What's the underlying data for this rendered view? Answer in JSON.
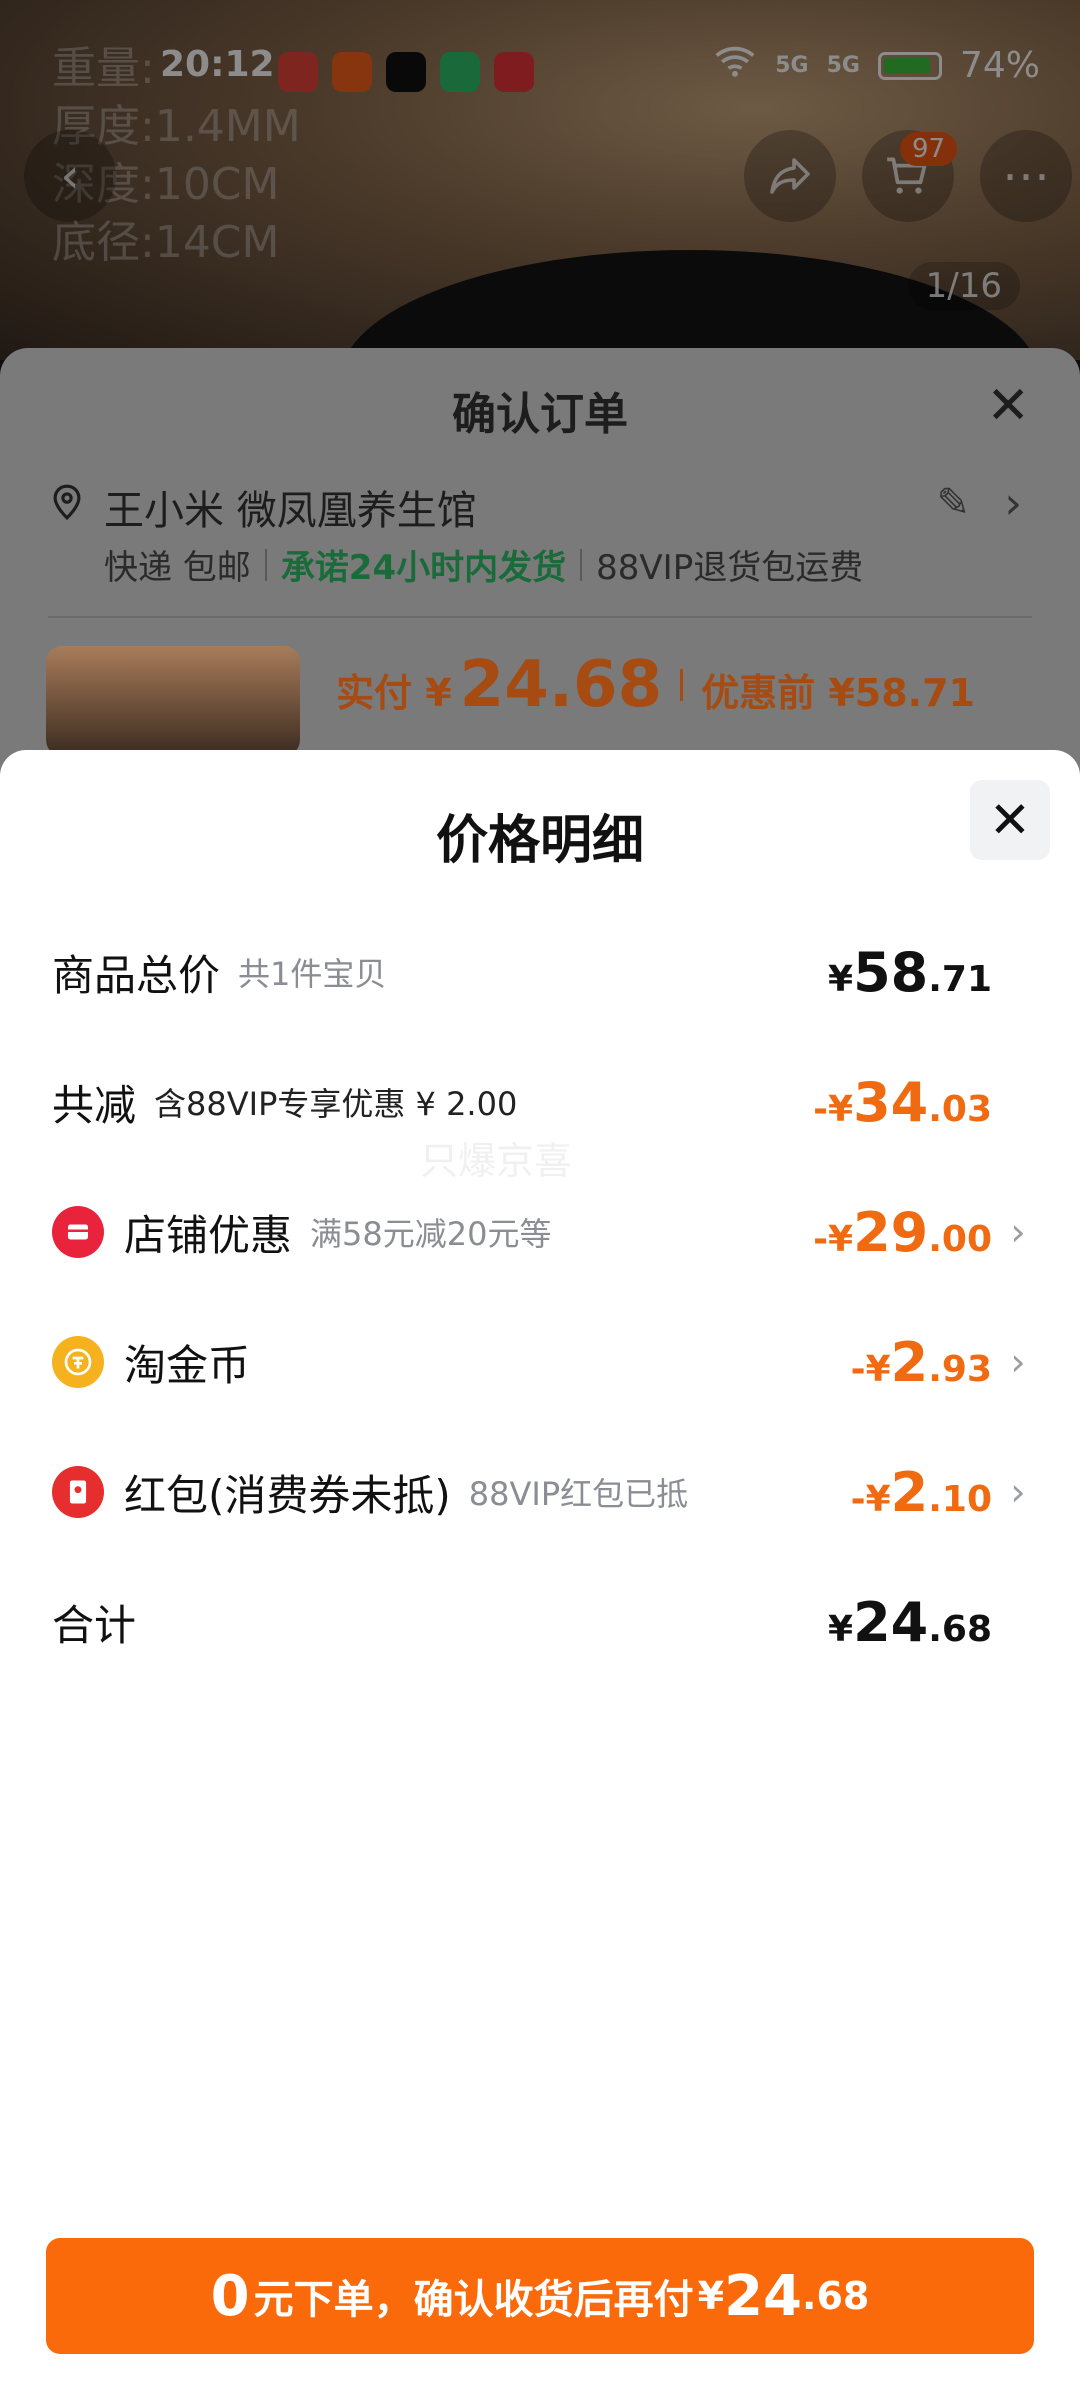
{
  "status_bar": {
    "time": "20:12",
    "signal_1": "5G",
    "signal_2": "5G",
    "battery": "74%"
  },
  "background": {
    "specs": [
      "重量:",
      "厚度:1.4MM",
      "深度:10CM",
      "底径:14CM"
    ],
    "image_counter": "1/16",
    "cart_count": "97"
  },
  "order_sheet": {
    "title": "确认订单",
    "address_name": "王小米 微凤凰养生馆",
    "shipping": "快递 包邮",
    "promise": "承诺24小时内发货",
    "return_info": "88VIP退货包运费",
    "pay_label": "实付 ¥",
    "pay_amount": "24.68",
    "before_discount": "优惠前 ¥58.71"
  },
  "price_detail": {
    "title": "价格明细",
    "watermark": "只爆京喜",
    "rows": {
      "total": {
        "label": "商品总价",
        "sub": "共1件宝贝",
        "sym": "¥",
        "int": "58",
        "dec": ".71"
      },
      "reduce": {
        "label": "共减",
        "sub": "含88VIP专享优惠 ¥ 2.00",
        "sym": "-¥",
        "int": "34",
        "dec": ".03"
      },
      "shop": {
        "label": "店铺优惠",
        "sub": "满58元减20元等",
        "sym": "-¥",
        "int": "29",
        "dec": ".00"
      },
      "coin": {
        "label": "淘金币",
        "sub": "",
        "sym": "-¥",
        "int": "2",
        "dec": ".93"
      },
      "redpack": {
        "label": "红包(消费券未抵)",
        "sub": "88VIP红包已抵",
        "sym": "-¥",
        "int": "2",
        "dec": ".10"
      },
      "sum": {
        "label": "合计",
        "sub": "",
        "sym": "¥",
        "int": "24",
        "dec": ".68"
      }
    },
    "submit": {
      "zero": "0",
      "text": "元下单，确认收货后再付",
      "sym": "¥",
      "int": "24",
      "dec": ".68"
    }
  },
  "colors": {
    "accent": "#FA6A0A",
    "discount": "#F06A12",
    "shop_badge": "#E8233B",
    "coin_badge": "#F5B21E",
    "redpack_badge": "#E62E2E"
  }
}
